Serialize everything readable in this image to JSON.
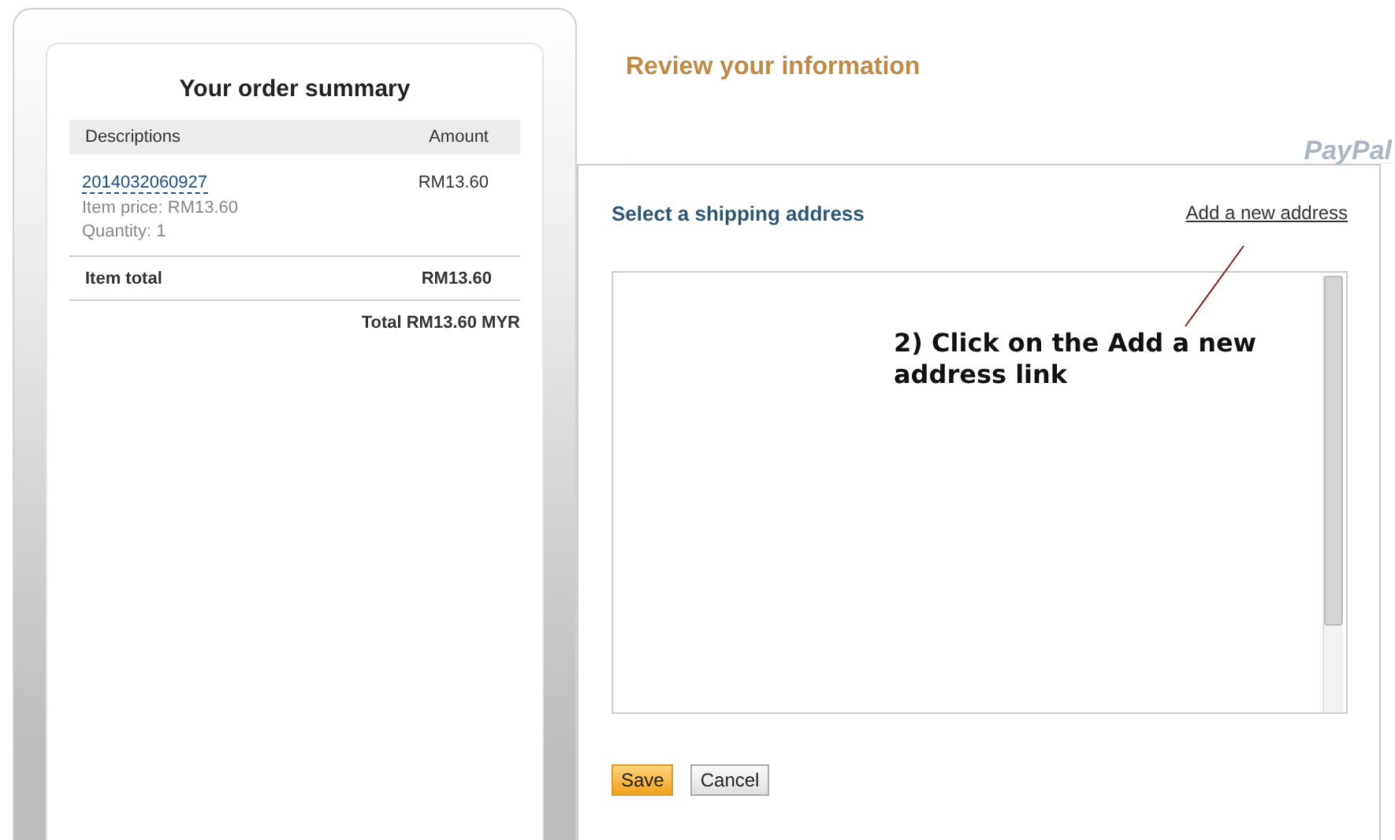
{
  "order_summary": {
    "title": "Your order summary",
    "columns": [
      "Descriptions",
      "Amount"
    ],
    "items": [
      {
        "name": "2014032060927",
        "details": [
          "Item price: RM13.60",
          "Quantity: 1"
        ],
        "amount": "RM13.60"
      }
    ],
    "item_total": {
      "label": "Item total",
      "amount": "RM13.60"
    },
    "total": "Total RM13.60 MYR"
  },
  "review": {
    "title": "Review your information",
    "logo": "PayPal",
    "section_title": "Select a shipping address",
    "link": "Add a new address",
    "annotation": "2) Click on the Add a new address link",
    "buttons": [
      {
        "label": "Save",
        "kind": "primary"
      },
      {
        "label": "Cancel",
        "kind": "secondary"
      }
    ]
  }
}
